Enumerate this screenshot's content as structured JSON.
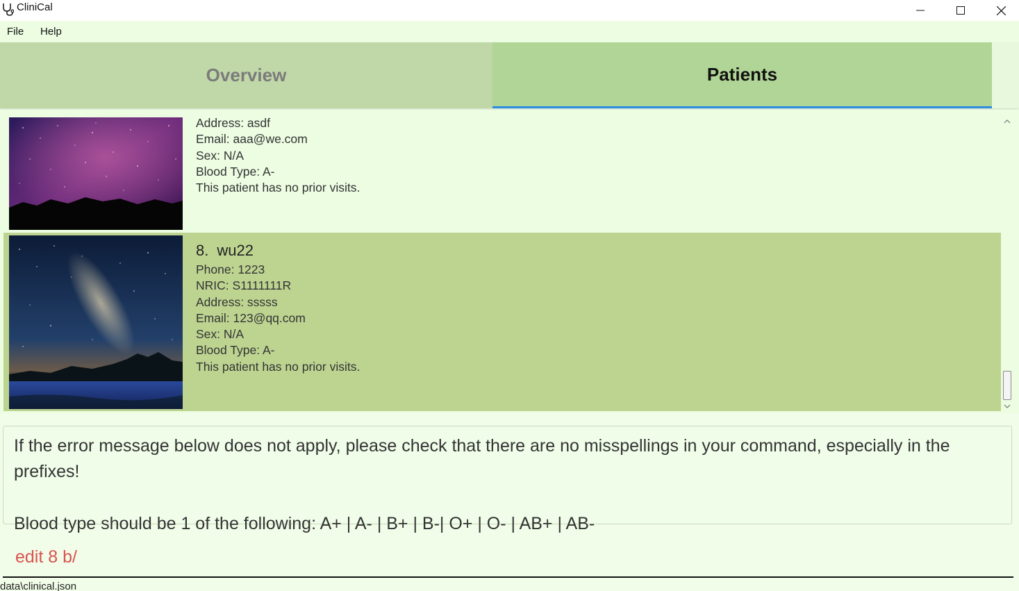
{
  "window": {
    "title": "CliniCal"
  },
  "menu": {
    "file": "File",
    "help": "Help"
  },
  "tabs": {
    "overview": "Overview",
    "patients": "Patients",
    "selected": "Patients"
  },
  "patients": [
    {
      "address": "Address: asdf",
      "email": "Email: aaa@we.com",
      "sex": "Sex: N/A",
      "blood_type": "Blood Type: A-",
      "visits": "This patient has no prior visits.",
      "photo": "purple-milky-way-mountains"
    },
    {
      "index": "8.",
      "name": "wu22",
      "phone": "Phone: 1223",
      "nric": "NRIC: S1111111R",
      "address": "Address: sssss",
      "email": "Email: 123@qq.com",
      "sex": "Sex: N/A",
      "blood_type": "Blood Type: A-",
      "visits": "This patient has no prior visits.",
      "photo": "milky-way-over-lake",
      "selected": true
    }
  ],
  "result": {
    "line1": "If the error message below does not apply, please check that there are no misspellings in your command, especially in the prefixes!",
    "line2": "Blood type should be 1 of the following: A+ | A- | B+ | B-| O+ | O- | AB+ | AB-"
  },
  "command": {
    "value": "edit 8 b/"
  },
  "status": {
    "path": "data\\clinical.json"
  },
  "colors": {
    "background": "#f1fde8",
    "tab_selected": "#b0d596",
    "tab_unselected": "#c0d7a8",
    "selected_row": "#bdd491",
    "tab_indicator": "#2a8de0",
    "command_text": "#d9534f"
  }
}
